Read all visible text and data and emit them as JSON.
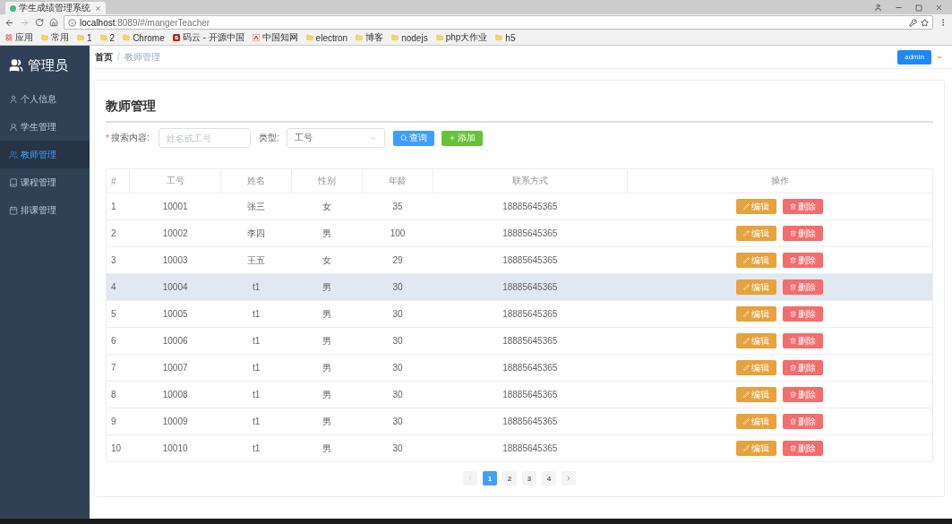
{
  "browser": {
    "tab_title": "学生成绩管理系统",
    "url_host": "localhost",
    "url_path": ":8089/#/mangerTeacher",
    "bookmarks": [
      {
        "label": "应用",
        "kind": "apps"
      },
      {
        "label": "常用",
        "kind": "folder"
      },
      {
        "label": "1",
        "kind": "folder"
      },
      {
        "label": "2",
        "kind": "folder"
      },
      {
        "label": "Chrome",
        "kind": "folder"
      },
      {
        "label": "码云 - 开源中国",
        "kind": "gitee"
      },
      {
        "label": "中国知网",
        "kind": "cnki"
      },
      {
        "label": "electron",
        "kind": "folder"
      },
      {
        "label": "博客",
        "kind": "folder"
      },
      {
        "label": "nodejs",
        "kind": "folder"
      },
      {
        "label": "php大作业",
        "kind": "folder"
      },
      {
        "label": "h5",
        "kind": "folder"
      }
    ]
  },
  "sidebar": {
    "title": "管理员",
    "items": [
      {
        "label": "个人信息",
        "kind": "user",
        "selected": false
      },
      {
        "label": "学生管理",
        "kind": "student",
        "selected": false
      },
      {
        "label": "教师管理",
        "kind": "teacher",
        "selected": true
      },
      {
        "label": "课程管理",
        "kind": "course",
        "selected": false
      },
      {
        "label": "排课管理",
        "kind": "calendar",
        "selected": false
      }
    ]
  },
  "header": {
    "breadcrumb": [
      "首页",
      "教师管理"
    ],
    "separator": "/",
    "user_button": "admin"
  },
  "page": {
    "title": "教师管理",
    "search": {
      "label": "搜索内容:",
      "required_mark": "*",
      "placeholder": "姓名或工号"
    },
    "type": {
      "label": "类型:",
      "value": "工号"
    },
    "query_button": "查询",
    "add_button": "添加"
  },
  "table": {
    "columns": [
      "#",
      "工号",
      "姓名",
      "性别",
      "年龄",
      "联系方式",
      "操作"
    ],
    "rows": [
      {
        "cells": [
          "1",
          "10001",
          "张三",
          "女",
          "35",
          "18885645365"
        ],
        "edit": "编辑",
        "delete": "删除",
        "hovered": false
      },
      {
        "cells": [
          "2",
          "10002",
          "李四",
          "男",
          "100",
          "18885645365"
        ],
        "edit": "编辑",
        "delete": "删除",
        "hovered": false
      },
      {
        "cells": [
          "3",
          "10003",
          "王五",
          "女",
          "29",
          "18885645365"
        ],
        "edit": "编辑",
        "delete": "删除",
        "hovered": false
      },
      {
        "cells": [
          "4",
          "10004",
          "t1",
          "男",
          "30",
          "18885645365"
        ],
        "edit": "编辑",
        "delete": "删除",
        "hovered": true
      },
      {
        "cells": [
          "5",
          "10005",
          "t1",
          "男",
          "30",
          "18885645365"
        ],
        "edit": "编辑",
        "delete": "删除",
        "hovered": false
      },
      {
        "cells": [
          "6",
          "10006",
          "t1",
          "男",
          "30",
          "18885645365"
        ],
        "edit": "编辑",
        "delete": "删除",
        "hovered": false
      },
      {
        "cells": [
          "7",
          "10007",
          "t1",
          "男",
          "30",
          "18885645365"
        ],
        "edit": "编辑",
        "delete": "删除",
        "hovered": false
      },
      {
        "cells": [
          "8",
          "10008",
          "t1",
          "男",
          "30",
          "18885645365"
        ],
        "edit": "编辑",
        "delete": "删除",
        "hovered": false
      },
      {
        "cells": [
          "9",
          "10009",
          "t1",
          "男",
          "30",
          "18885645365"
        ],
        "edit": "编辑",
        "delete": "删除",
        "hovered": false
      },
      {
        "cells": [
          "10",
          "10010",
          "t1",
          "男",
          "30",
          "18885645365"
        ],
        "edit": "编辑",
        "delete": "删除",
        "hovered": false
      }
    ]
  },
  "pagination": {
    "pages": [
      {
        "label": "1",
        "selected": true
      },
      {
        "label": "2",
        "selected": false
      },
      {
        "label": "3",
        "selected": false
      },
      {
        "label": "4",
        "selected": false
      }
    ],
    "prev_disabled": true,
    "next_disabled": false
  }
}
